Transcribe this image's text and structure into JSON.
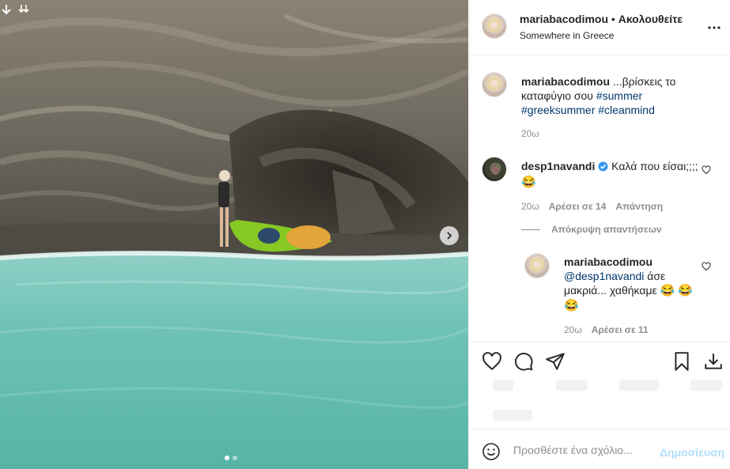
{
  "header": {
    "username": "mariabacodimou",
    "separator": "•",
    "follow_label": "Ακολουθείτε",
    "location": "Somewhere in Greece"
  },
  "caption": {
    "username": "mariabacodimou",
    "text": "...βρίσκεις το καταφύγιο σου",
    "hashtags": [
      "#summer",
      "#greeksummer",
      "#cleanmind"
    ],
    "time": "20ω"
  },
  "comments": [
    {
      "username": "desp1navandi",
      "verified": true,
      "text": "Καλά που είσαι;;;;",
      "emoji": "😂",
      "time": "20ω",
      "likes": "Αρέσει σε 14",
      "reply_label": "Απάντηση"
    }
  ],
  "hide_replies_label": "Απόκρυψη απαντήσεων",
  "reply": {
    "username": "mariabacodimou",
    "mention": "@desp1navandi",
    "text": "άσε μακριά... χαθήκαμε",
    "emoji1": "😂",
    "emoji2": "😂",
    "emoji3": "😂",
    "time": "20ω",
    "likes": "Αρέσει σε 11"
  },
  "add_comment": {
    "placeholder": "Προσθέστε ένα σχόλιο...",
    "post_label": "Δημοσίευση"
  },
  "icons": {
    "more": "more-horizontal-icon",
    "like": "heart-icon",
    "comment": "comment-bubble-icon",
    "share": "paper-plane-icon",
    "save": "bookmark-icon",
    "download": "download-icon",
    "emoji": "smiley-icon",
    "next": "chevron-right-icon"
  },
  "carousel": {
    "total": 2,
    "current": 1
  },
  "colors": {
    "link": "#00376b",
    "muted": "#8e8e8e",
    "post_disabled": "#b2dffc",
    "verified": "#3897f0"
  }
}
